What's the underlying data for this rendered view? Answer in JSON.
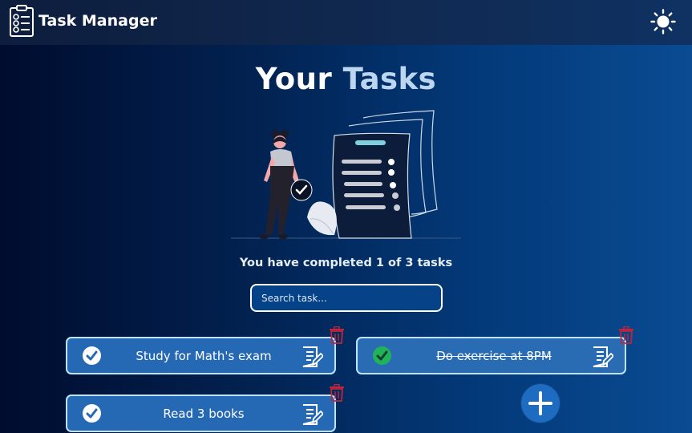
{
  "header": {
    "title": "Task Manager",
    "logo_icon": "clipboard-checklist-icon",
    "theme_icon": "sun-icon"
  },
  "page": {
    "title_part1": "Your ",
    "title_part2": "Tasks",
    "status_text": "You have completed 1 of 3 tasks"
  },
  "search": {
    "placeholder": "Search task..."
  },
  "tasks": [
    {
      "text": "Study for Math's exam",
      "completed": false
    },
    {
      "text": "Do exercise at 8PM",
      "completed": true
    },
    {
      "text": "Read 3 books",
      "completed": false
    }
  ],
  "colors": {
    "header_bg": "#0f2a52",
    "card_bg": "#2569b4",
    "card_border": "#bfe3ff",
    "completed_green": "#21b35a",
    "delete_red": "#c0253a",
    "add_button": "#1d6cc2"
  }
}
